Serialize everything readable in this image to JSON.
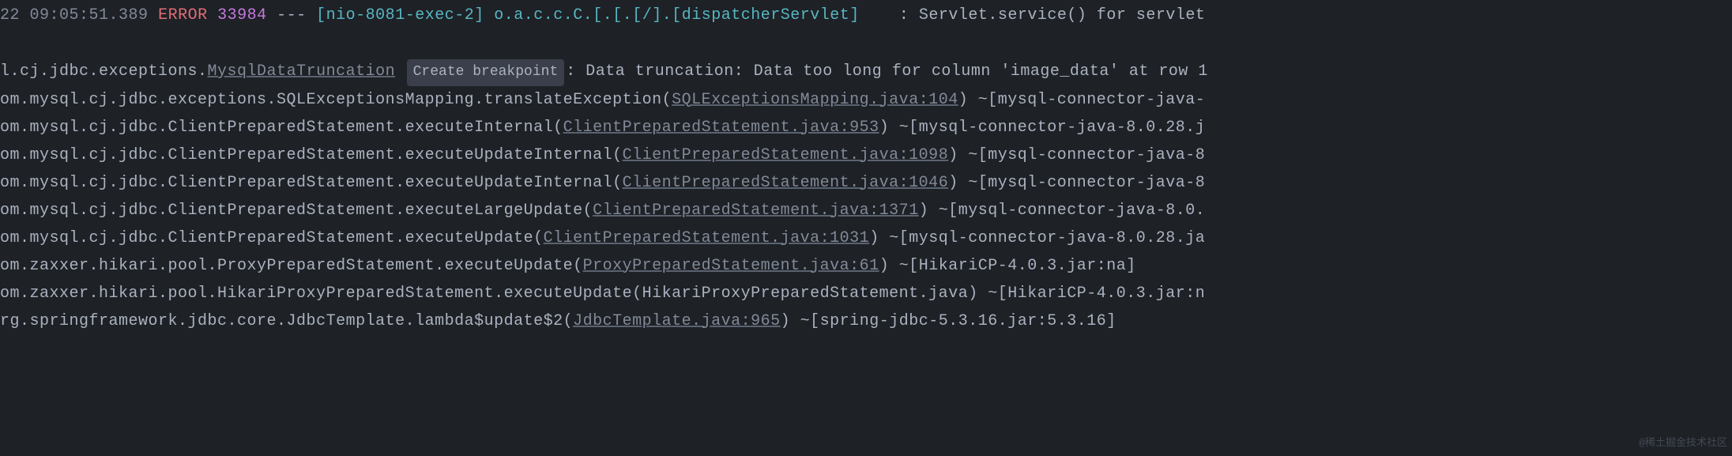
{
  "header": {
    "date_fragment": "22",
    "time": "09:05:51.389",
    "level": "ERROR",
    "pid": "33984",
    "separator": "---",
    "thread": "[nio-8081-exec-2]",
    "logger": "o.a.c.c.C.[.[.[/].[dispatcherServlet]",
    "colon": ":",
    "message": "Servlet.service() for servlet"
  },
  "exception": {
    "prefix": "l.cj.jdbc.exceptions.",
    "class_link": "MysqlDataTruncation",
    "breakpoint_label": "Create breakpoint",
    "message": ": Data truncation: Data too long for column 'image_data' at row 1"
  },
  "stack": [
    {
      "prefix": "om.mysql.cj.jdbc.exceptions.SQLExceptionsMapping.translateException(",
      "link": "SQLExceptionsMapping.java:104",
      "suffix": ") ~[mysql-connector-java-"
    },
    {
      "prefix": "om.mysql.cj.jdbc.ClientPreparedStatement.executeInternal(",
      "link": "ClientPreparedStatement.java:953",
      "suffix": ") ~[mysql-connector-java-8.0.28.j"
    },
    {
      "prefix": "om.mysql.cj.jdbc.ClientPreparedStatement.executeUpdateInternal(",
      "link": "ClientPreparedStatement.java:1098",
      "suffix": ") ~[mysql-connector-java-8"
    },
    {
      "prefix": "om.mysql.cj.jdbc.ClientPreparedStatement.executeUpdateInternal(",
      "link": "ClientPreparedStatement.java:1046",
      "suffix": ") ~[mysql-connector-java-8"
    },
    {
      "prefix": "om.mysql.cj.jdbc.ClientPreparedStatement.executeLargeUpdate(",
      "link": "ClientPreparedStatement.java:1371",
      "suffix": ") ~[mysql-connector-java-8.0."
    },
    {
      "prefix": "om.mysql.cj.jdbc.ClientPreparedStatement.executeUpdate(",
      "link": "ClientPreparedStatement.java:1031",
      "suffix": ") ~[mysql-connector-java-8.0.28.ja"
    },
    {
      "prefix": "om.zaxxer.hikari.pool.ProxyPreparedStatement.executeUpdate(",
      "link": "ProxyPreparedStatement.java:61",
      "suffix": ") ~[HikariCP-4.0.3.jar:na]"
    },
    {
      "prefix": "om.zaxxer.hikari.pool.HikariProxyPreparedStatement.executeUpdate(HikariProxyPreparedStatement.java) ~[HikariCP-4.0.3.jar:n",
      "link": "",
      "suffix": ""
    },
    {
      "prefix": "rg.springframework.jdbc.core.JdbcTemplate.lambda$update$2(",
      "link": "JdbcTemplate.java:965",
      "suffix": ") ~[spring-jdbc-5.3.16.jar:5.3.16]"
    }
  ],
  "watermark": "@稀土掘金技术社区"
}
